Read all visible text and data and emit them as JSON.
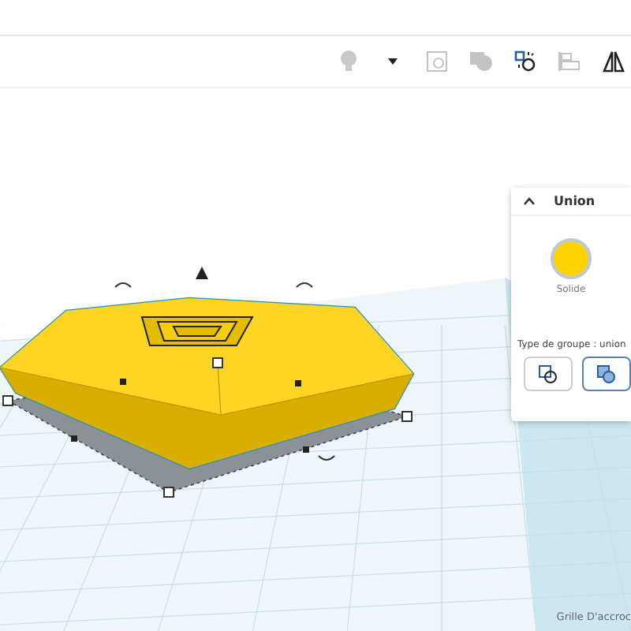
{
  "toolbar": [
    {
      "kind": "bulb",
      "disabled": true
    },
    {
      "kind": "caret",
      "disabled": false
    },
    {
      "kind": "group",
      "disabled": true
    },
    {
      "kind": "shape",
      "disabled": true
    },
    {
      "kind": "ungroup",
      "disabled": false
    },
    {
      "kind": "align",
      "disabled": true
    },
    {
      "kind": "mirror",
      "disabled": false
    }
  ],
  "inspector": {
    "title": "Union",
    "expanded": true,
    "color_label": "Solide",
    "group_type_label": "Type de groupe : union",
    "group_types": [
      {
        "kind": "separate",
        "selected": false
      },
      {
        "kind": "merged",
        "selected": true
      }
    ]
  },
  "status": {
    "snap_grid": "Grille D'accroc"
  }
}
